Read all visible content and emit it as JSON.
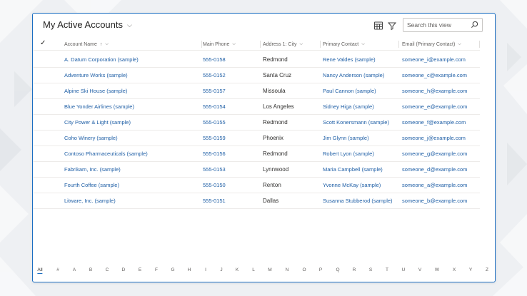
{
  "view": {
    "title": "My Active Accounts",
    "search_placeholder": "Search this view"
  },
  "icons": {
    "edit_columns": "edit-columns-icon",
    "filter": "filter-icon",
    "search": "search-icon"
  },
  "columns": [
    {
      "label": "Account Name",
      "sorted": "ascending"
    },
    {
      "label": "Main Phone"
    },
    {
      "label": "Address 1: City"
    },
    {
      "label": "Primary Contact"
    },
    {
      "label": "Email (Primary Contact)"
    }
  ],
  "rows": [
    {
      "name": "A. Datum Corporation (sample)",
      "phone": "555-0158",
      "city": "Redmond",
      "contact": "Rene Valdes (sample)",
      "email": "someone_i@example.com"
    },
    {
      "name": "Adventure Works (sample)",
      "phone": "555-0152",
      "city": "Santa Cruz",
      "contact": "Nancy Anderson (sample)",
      "email": "someone_c@example.com"
    },
    {
      "name": "Alpine Ski House (sample)",
      "phone": "555-0157",
      "city": "Missoula",
      "contact": "Paul Cannon (sample)",
      "email": "someone_h@example.com"
    },
    {
      "name": "Blue Yonder Airlines (sample)",
      "phone": "555-0154",
      "city": "Los Angeles",
      "contact": "Sidney Higa (sample)",
      "email": "someone_e@example.com"
    },
    {
      "name": "City Power & Light (sample)",
      "phone": "555-0155",
      "city": "Redmond",
      "contact": "Scott Konersmann (sample)",
      "email": "someone_f@example.com"
    },
    {
      "name": "Coho Winery (sample)",
      "phone": "555-0159",
      "city": "Phoenix",
      "contact": "Jim Glynn (sample)",
      "email": "someone_j@example.com"
    },
    {
      "name": "Contoso Pharmaceuticals (sample)",
      "phone": "555-0156",
      "city": "Redmond",
      "contact": "Robert Lyon (sample)",
      "email": "someone_g@example.com"
    },
    {
      "name": "Fabrikam, Inc. (sample)",
      "phone": "555-0153",
      "city": "Lynnwood",
      "contact": "Maria Campbell (sample)",
      "email": "someone_d@example.com"
    },
    {
      "name": "Fourth Coffee (sample)",
      "phone": "555-0150",
      "city": "Renton",
      "contact": "Yvonne McKay (sample)",
      "email": "someone_a@example.com"
    },
    {
      "name": "Litware, Inc. (sample)",
      "phone": "555-0151",
      "city": "Dallas",
      "contact": "Susanna Stubberod (sample)",
      "email": "someone_b@example.com"
    }
  ],
  "alphabet": [
    "All",
    "#",
    "A",
    "B",
    "C",
    "D",
    "E",
    "F",
    "G",
    "H",
    "I",
    "J",
    "K",
    "L",
    "M",
    "N",
    "O",
    "P",
    "Q",
    "R",
    "S",
    "T",
    "U",
    "V",
    "W",
    "X",
    "Y",
    "Z"
  ],
  "alphabet_selected": "All",
  "colors": {
    "accent": "#1b6ec2",
    "link": "#1f5fa6",
    "text": "#323130",
    "muted": "#605e5c",
    "background": "#eef0f3"
  }
}
